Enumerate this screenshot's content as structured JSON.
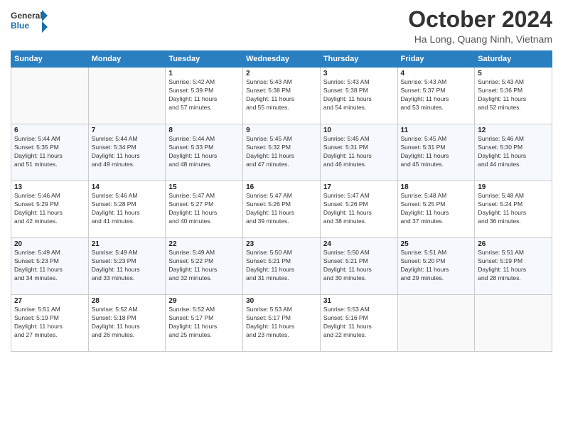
{
  "header": {
    "title": "October 2024",
    "location": "Ha Long, Quang Ninh, Vietnam"
  },
  "calendar": {
    "headers": [
      "Sunday",
      "Monday",
      "Tuesday",
      "Wednesday",
      "Thursday",
      "Friday",
      "Saturday"
    ],
    "rows": [
      [
        {
          "day": "",
          "info": ""
        },
        {
          "day": "",
          "info": ""
        },
        {
          "day": "1",
          "info": "Sunrise: 5:42 AM\nSunset: 5:39 PM\nDaylight: 11 hours\nand 57 minutes."
        },
        {
          "day": "2",
          "info": "Sunrise: 5:43 AM\nSunset: 5:38 PM\nDaylight: 11 hours\nand 55 minutes."
        },
        {
          "day": "3",
          "info": "Sunrise: 5:43 AM\nSunset: 5:38 PM\nDaylight: 11 hours\nand 54 minutes."
        },
        {
          "day": "4",
          "info": "Sunrise: 5:43 AM\nSunset: 5:37 PM\nDaylight: 11 hours\nand 53 minutes."
        },
        {
          "day": "5",
          "info": "Sunrise: 5:43 AM\nSunset: 5:36 PM\nDaylight: 11 hours\nand 52 minutes."
        }
      ],
      [
        {
          "day": "6",
          "info": "Sunrise: 5:44 AM\nSunset: 5:35 PM\nDaylight: 11 hours\nand 51 minutes."
        },
        {
          "day": "7",
          "info": "Sunrise: 5:44 AM\nSunset: 5:34 PM\nDaylight: 11 hours\nand 49 minutes."
        },
        {
          "day": "8",
          "info": "Sunrise: 5:44 AM\nSunset: 5:33 PM\nDaylight: 11 hours\nand 48 minutes."
        },
        {
          "day": "9",
          "info": "Sunrise: 5:45 AM\nSunset: 5:32 PM\nDaylight: 11 hours\nand 47 minutes."
        },
        {
          "day": "10",
          "info": "Sunrise: 5:45 AM\nSunset: 5:31 PM\nDaylight: 11 hours\nand 46 minutes."
        },
        {
          "day": "11",
          "info": "Sunrise: 5:45 AM\nSunset: 5:31 PM\nDaylight: 11 hours\nand 45 minutes."
        },
        {
          "day": "12",
          "info": "Sunrise: 5:46 AM\nSunset: 5:30 PM\nDaylight: 11 hours\nand 44 minutes."
        }
      ],
      [
        {
          "day": "13",
          "info": "Sunrise: 5:46 AM\nSunset: 5:29 PM\nDaylight: 11 hours\nand 42 minutes."
        },
        {
          "day": "14",
          "info": "Sunrise: 5:46 AM\nSunset: 5:28 PM\nDaylight: 11 hours\nand 41 minutes."
        },
        {
          "day": "15",
          "info": "Sunrise: 5:47 AM\nSunset: 5:27 PM\nDaylight: 11 hours\nand 40 minutes."
        },
        {
          "day": "16",
          "info": "Sunrise: 5:47 AM\nSunset: 5:26 PM\nDaylight: 11 hours\nand 39 minutes."
        },
        {
          "day": "17",
          "info": "Sunrise: 5:47 AM\nSunset: 5:26 PM\nDaylight: 11 hours\nand 38 minutes."
        },
        {
          "day": "18",
          "info": "Sunrise: 5:48 AM\nSunset: 5:25 PM\nDaylight: 11 hours\nand 37 minutes."
        },
        {
          "day": "19",
          "info": "Sunrise: 5:48 AM\nSunset: 5:24 PM\nDaylight: 11 hours\nand 36 minutes."
        }
      ],
      [
        {
          "day": "20",
          "info": "Sunrise: 5:49 AM\nSunset: 5:23 PM\nDaylight: 11 hours\nand 34 minutes."
        },
        {
          "day": "21",
          "info": "Sunrise: 5:49 AM\nSunset: 5:23 PM\nDaylight: 11 hours\nand 33 minutes."
        },
        {
          "day": "22",
          "info": "Sunrise: 5:49 AM\nSunset: 5:22 PM\nDaylight: 11 hours\nand 32 minutes."
        },
        {
          "day": "23",
          "info": "Sunrise: 5:50 AM\nSunset: 5:21 PM\nDaylight: 11 hours\nand 31 minutes."
        },
        {
          "day": "24",
          "info": "Sunrise: 5:50 AM\nSunset: 5:21 PM\nDaylight: 11 hours\nand 30 minutes."
        },
        {
          "day": "25",
          "info": "Sunrise: 5:51 AM\nSunset: 5:20 PM\nDaylight: 11 hours\nand 29 minutes."
        },
        {
          "day": "26",
          "info": "Sunrise: 5:51 AM\nSunset: 5:19 PM\nDaylight: 11 hours\nand 28 minutes."
        }
      ],
      [
        {
          "day": "27",
          "info": "Sunrise: 5:51 AM\nSunset: 5:19 PM\nDaylight: 11 hours\nand 27 minutes."
        },
        {
          "day": "28",
          "info": "Sunrise: 5:52 AM\nSunset: 5:18 PM\nDaylight: 11 hours\nand 26 minutes."
        },
        {
          "day": "29",
          "info": "Sunrise: 5:52 AM\nSunset: 5:17 PM\nDaylight: 11 hours\nand 25 minutes."
        },
        {
          "day": "30",
          "info": "Sunrise: 5:53 AM\nSunset: 5:17 PM\nDaylight: 11 hours\nand 23 minutes."
        },
        {
          "day": "31",
          "info": "Sunrise: 5:53 AM\nSunset: 5:16 PM\nDaylight: 11 hours\nand 22 minutes."
        },
        {
          "day": "",
          "info": ""
        },
        {
          "day": "",
          "info": ""
        }
      ]
    ]
  }
}
